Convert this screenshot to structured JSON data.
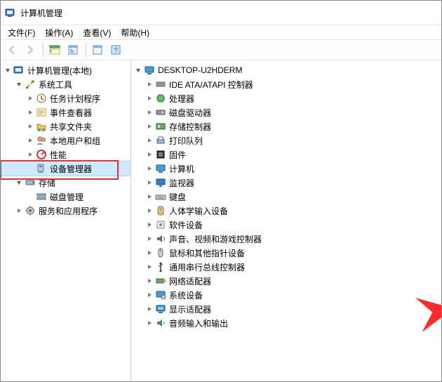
{
  "window": {
    "title": "计算机管理"
  },
  "menu": {
    "file": "文件(F)",
    "action": "操作(A)",
    "view": "查看(V)",
    "help": "帮助(H)"
  },
  "toolbar": {
    "back": {
      "name": "nav-back",
      "enabled": false
    },
    "forward": {
      "name": "nav-forward",
      "enabled": false
    },
    "up": {
      "name": "show-hide-tree",
      "enabled": true
    },
    "properties": {
      "name": "properties",
      "enabled": true
    },
    "refresh": {
      "name": "refresh",
      "enabled": true
    },
    "help": {
      "name": "help-btn",
      "enabled": true
    }
  },
  "left_tree": {
    "root": {
      "label": "计算机管理(本地)",
      "icon": "computer-mgmt-icon",
      "expanded": true,
      "children": [
        {
          "label": "系统工具",
          "icon": "tools-icon",
          "expanded": true,
          "children": [
            {
              "label": "任务计划程序",
              "icon": "task-scheduler-icon",
              "expandable": true
            },
            {
              "label": "事件查看器",
              "icon": "event-viewer-icon",
              "expandable": true
            },
            {
              "label": "共享文件夹",
              "icon": "shared-folders-icon",
              "expandable": true
            },
            {
              "label": "本地用户和组",
              "icon": "local-users-icon",
              "expandable": true
            },
            {
              "label": "性能",
              "icon": "performance-icon",
              "expandable": true
            },
            {
              "label": "设备管理器",
              "icon": "device-manager-icon",
              "expandable": false,
              "selected": true,
              "highlighted": true
            }
          ]
        },
        {
          "label": "存储",
          "icon": "storage-icon",
          "expanded": true,
          "children": [
            {
              "label": "磁盘管理",
              "icon": "disk-mgmt-icon",
              "expandable": false
            }
          ]
        },
        {
          "label": "服务和应用程序",
          "icon": "services-apps-icon",
          "expandable": true
        }
      ]
    }
  },
  "right_tree": {
    "root": {
      "label": "DESKTOP-U2HDERM",
      "icon": "computer-icon",
      "expanded": true,
      "children": [
        {
          "label": "IDE ATA/ATAPI 控制器",
          "icon": "ide-controller-icon"
        },
        {
          "label": "处理器",
          "icon": "cpu-icon"
        },
        {
          "label": "磁盘驱动器",
          "icon": "disk-drive-icon"
        },
        {
          "label": "存储控制器",
          "icon": "storage-controller-icon"
        },
        {
          "label": "打印队列",
          "icon": "print-queue-icon"
        },
        {
          "label": "固件",
          "icon": "firmware-icon"
        },
        {
          "label": "计算机",
          "icon": "computer-icon"
        },
        {
          "label": "监视器",
          "icon": "monitor-icon"
        },
        {
          "label": "键盘",
          "icon": "keyboard-icon"
        },
        {
          "label": "人体学输入设备",
          "icon": "hid-icon"
        },
        {
          "label": "软件设备",
          "icon": "software-device-icon"
        },
        {
          "label": "声音、视频和游戏控制器",
          "icon": "audio-icon"
        },
        {
          "label": "鼠标和其他指针设备",
          "icon": "mouse-icon"
        },
        {
          "label": "通用串行总线控制器",
          "icon": "usb-icon"
        },
        {
          "label": "网络适配器",
          "icon": "network-adapter-icon"
        },
        {
          "label": "系统设备",
          "icon": "system-device-icon"
        },
        {
          "label": "显示适配器",
          "icon": "display-adapter-icon",
          "arrow_target": true
        },
        {
          "label": "音频输入和输出",
          "icon": "audio-io-icon"
        }
      ]
    }
  },
  "annotation": {
    "arrow_color": "#ff2a2a",
    "highlight_color": "#ff2a2a"
  }
}
